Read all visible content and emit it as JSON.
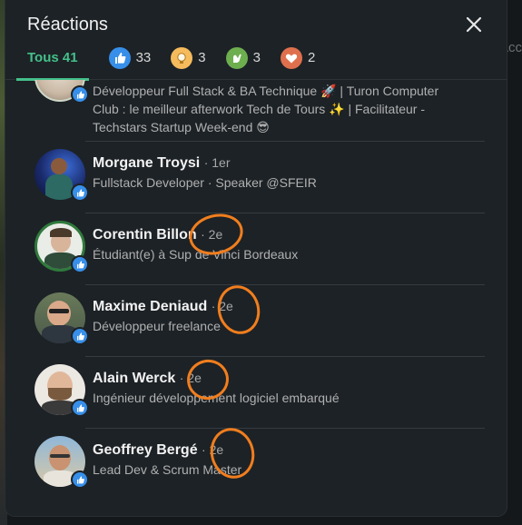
{
  "dialog": {
    "title": "Réactions"
  },
  "background": {
    "right_text": "Acc"
  },
  "tabs": [
    {
      "label": "Tous 41",
      "icon": "all",
      "active": true
    },
    {
      "count": "33",
      "icon": "like-icon",
      "color": "#378fe9"
    },
    {
      "count": "3",
      "icon": "insightful-icon",
      "color": "#f5bb5c"
    },
    {
      "count": "3",
      "icon": "support-icon",
      "color": "#6dae4f"
    },
    {
      "count": "2",
      "icon": "love-icon",
      "color": "#df704d"
    }
  ],
  "people": [
    {
      "name": "",
      "degree": "",
      "headline_lines": [
        "Développeur Full Stack & BA Technique 🚀 | Turon Computer",
        "Club : le meilleur afterwork Tech de Tours ✨ | Facilitateur -",
        "Techstars Startup Week-end 😎"
      ]
    },
    {
      "name": "Morgane Troysi",
      "degree": "· 1er",
      "headline": "Fullstack Developer · Speaker @SFEIR"
    },
    {
      "name": "Corentin Billon",
      "degree": "· 2e",
      "headline": "Étudiant(e) à Sup de Vinci Bordeaux"
    },
    {
      "name": "Maxime Deniaud",
      "degree": "· 2e",
      "headline": "Développeur freelance"
    },
    {
      "name": "Alain Werck",
      "degree": "· 2e",
      "headline": "Ingénieur développement logiciel embarqué"
    },
    {
      "name": "Geoffrey Bergé",
      "degree": "· 2e",
      "headline": "Lead Dev & Scrum Master"
    }
  ],
  "colors": {
    "accent": "#44c08a",
    "annotation": "#f07e1e",
    "like": "#378fe9"
  }
}
